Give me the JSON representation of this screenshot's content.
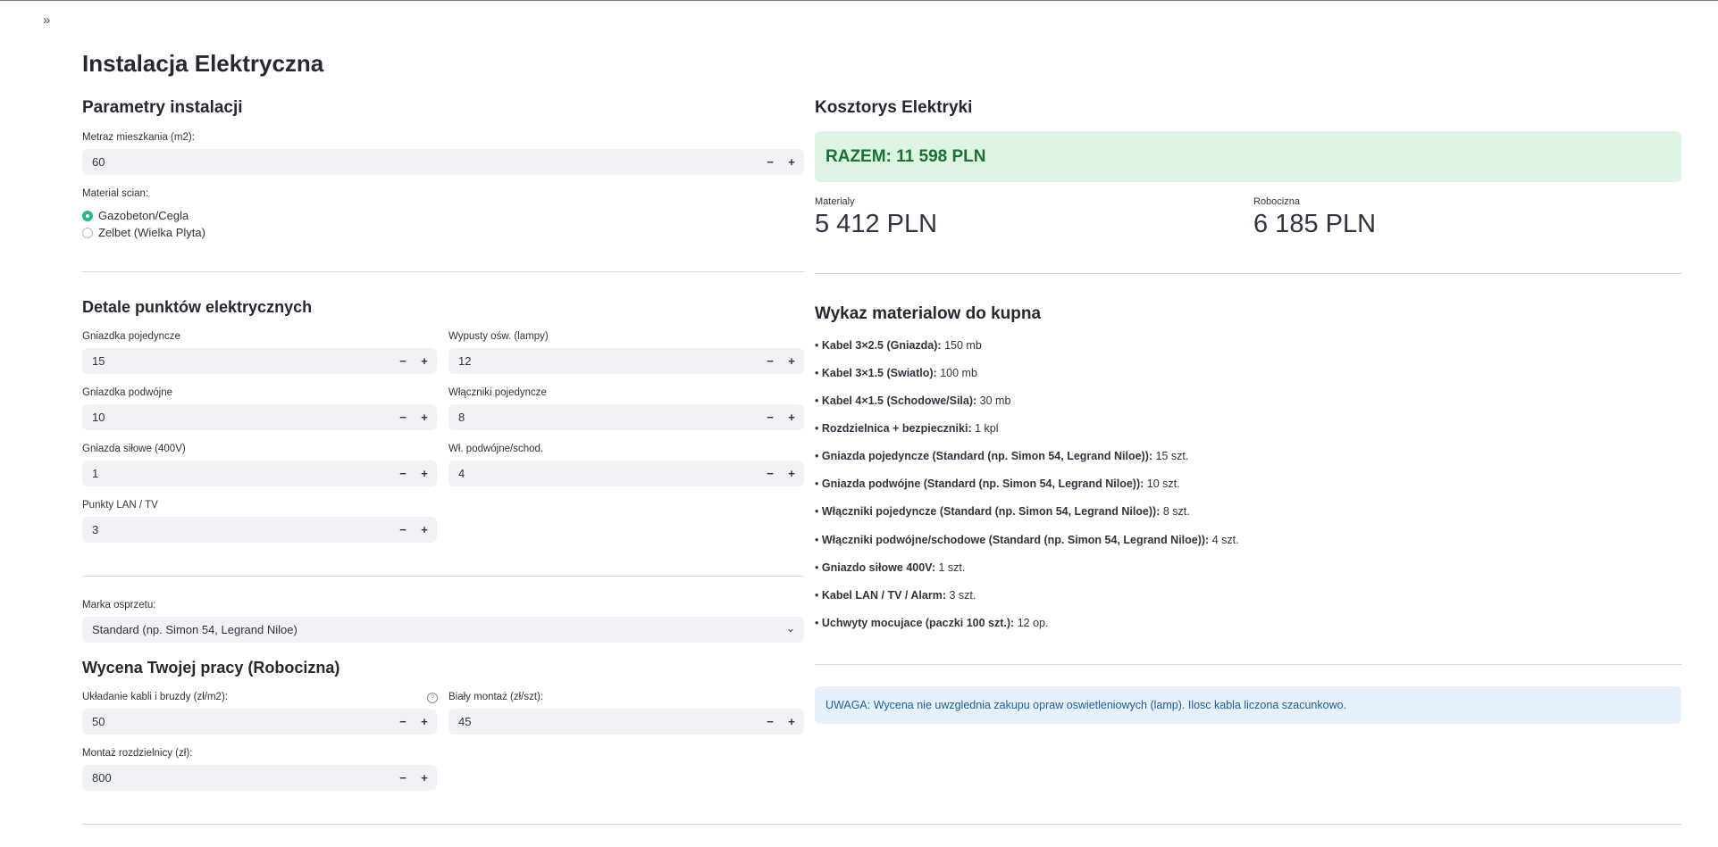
{
  "app": {
    "expand_icon": "double-chevron-right-icon",
    "title": "Instalacja Elektryczna"
  },
  "params": {
    "title": "Parametry instalacji",
    "area_label": "Metraz mieszkania (m2):",
    "area_value": "60",
    "wall_label": "Material scian:",
    "wall_options": [
      "Gazobeton/Cegla",
      "Zelbet (Wielka Plyta)"
    ],
    "wall_selected": "Gazobeton/Cegla"
  },
  "points": {
    "title": "Detale punktów elektrycznych",
    "fields": [
      {
        "label": "Gniazdka pojedyncze",
        "value": "15"
      },
      {
        "label": "Wypusty ośw. (lampy)",
        "value": "12"
      },
      {
        "label": "Gniazdka podwójne",
        "value": "10"
      },
      {
        "label": "Włączniki pojedyncze",
        "value": "8"
      },
      {
        "label": "Gniazda siłowe (400V)",
        "value": "1"
      },
      {
        "label": "Wł. podwójne/schod.",
        "value": "4"
      },
      {
        "label": "Punkty LAN / TV",
        "value": "3"
      }
    ]
  },
  "brand": {
    "label": "Marka osprzetu:",
    "selected": "Standard (np. Simon 54, Legrand Niloe)"
  },
  "labor": {
    "title": "Wycena Twojej pracy (Robocizna)",
    "fields": [
      {
        "label": "Układanie kabli i bruzdy (zł/m2):",
        "value": "50"
      },
      {
        "label": "Biały montaż (zł/szt):",
        "value": "45"
      },
      {
        "label": "Montaż rozdzielnicy (zł):",
        "value": "800"
      }
    ]
  },
  "estimate": {
    "title": "Kosztorys Elektryki",
    "total": "RAZEM: 11 598 PLN",
    "materials_label": "Materialy",
    "materials_value": "5 412 PLN",
    "labor_label": "Robocizna",
    "labor_value": "6 185 PLN"
  },
  "materials_list": {
    "title": "Wykaz materialow do kupna",
    "items": [
      {
        "name": "Kabel 3×2.5 (Gniazda):",
        "qty": "150 mb"
      },
      {
        "name": "Kabel 3×1.5 (Swiatlo):",
        "qty": "100 mb"
      },
      {
        "name": "Kabel 4×1.5 (Schodowe/Sila):",
        "qty": "30 mb"
      },
      {
        "name": "Rozdzielnica + bezpieczniki:",
        "qty": "1 kpl"
      },
      {
        "name": "Gniazda pojedyncze (Standard (np. Simon 54, Legrand Niloe)):",
        "qty": "15 szt."
      },
      {
        "name": "Gniazda podwójne (Standard (np. Simon 54, Legrand Niloe)):",
        "qty": "10 szt."
      },
      {
        "name": "Włączniki pojedyncze (Standard (np. Simon 54, Legrand Niloe)):",
        "qty": "8 szt."
      },
      {
        "name": "Włączniki podwójne/schodowe (Standard (np. Simon 54, Legrand Niloe)):",
        "qty": "4 szt."
      },
      {
        "name": "Gniazdo siłowe 400V:",
        "qty": "1 szt."
      },
      {
        "name": "Kabel LAN / TV / Alarm:",
        "qty": "3 szt."
      },
      {
        "name": "Uchwyty mocujace (paczki 100 szt.):",
        "qty": "12 op."
      }
    ]
  },
  "notice": "UWAGA: Wycena nie uwzglednia zakupu opraw oswietleniowych (lamp). Ilosc kabla liczona szacunkowo.",
  "colors": {
    "accent": "#2bb389",
    "success_bg": "#dff5e4",
    "success_text": "#177233",
    "info_bg": "#e7f1fc",
    "info_text": "#1d5fa8"
  }
}
